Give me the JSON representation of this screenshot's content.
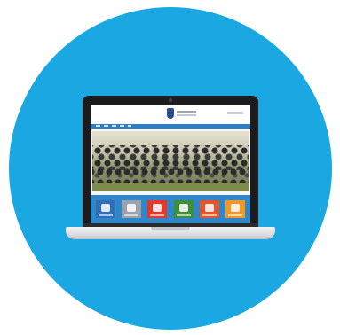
{
  "colors": {
    "circle_background": "#1ba7e1",
    "laptop_bezel": "#1c1c1e",
    "laptop_base": "#d7d9dd",
    "site_nav": "#2b7fc2",
    "site_tile_band": "#2f86c8"
  },
  "icons": {
    "logo": "emblem-icon",
    "camera": "camera-dot-icon"
  },
  "tiles": [
    {
      "icon": "tile-icon-1",
      "color": "#2f6fb8"
    },
    {
      "icon": "tile-icon-2",
      "color": "#9aa3ad"
    },
    {
      "icon": "tile-icon-3",
      "color": "#e03a2c"
    },
    {
      "icon": "tile-icon-4",
      "color": "#3f8f3a"
    },
    {
      "icon": "tile-icon-5",
      "color": "#e2572a"
    },
    {
      "icon": "tile-icon-6",
      "color": "#f0972a"
    }
  ]
}
